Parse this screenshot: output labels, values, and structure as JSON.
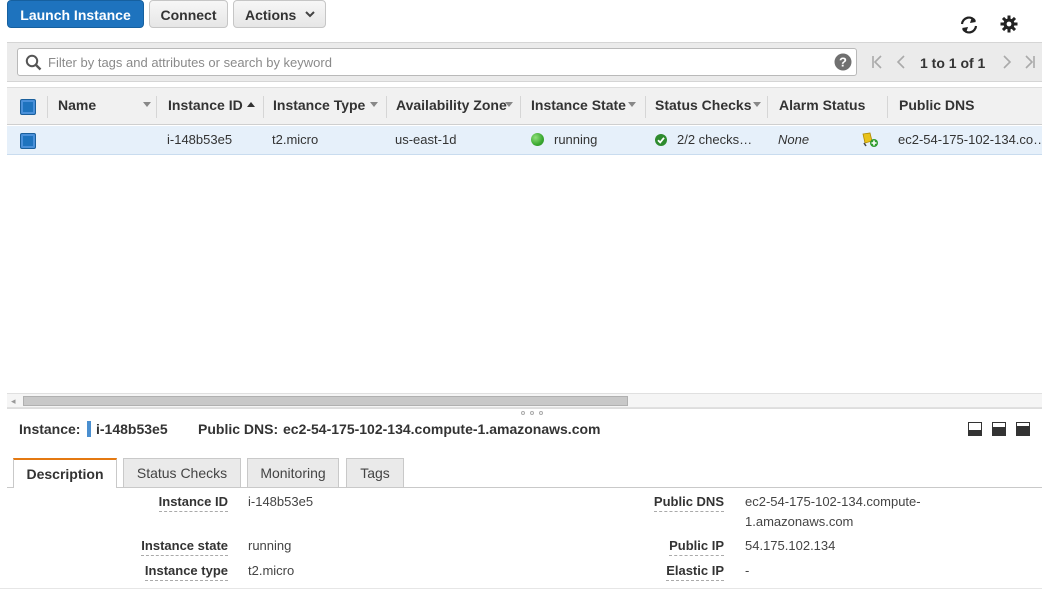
{
  "toolbar": {
    "launch_label": "Launch Instance",
    "connect_label": "Connect",
    "actions_label": "Actions",
    "refresh_icon": "refresh-icon",
    "settings_icon": "gear-icon"
  },
  "filter": {
    "placeholder": "Filter by tags and attributes or search by keyword",
    "help_icon": "question-icon",
    "pagination": "1 to 1 of 1"
  },
  "columns": [
    "Name",
    "Instance ID",
    "Instance Type",
    "Availability Zone",
    "Instance State",
    "Status Checks",
    "Alarm Status",
    "Public DNS"
  ],
  "rows": [
    {
      "name": "",
      "instance_id": "i-148b53e5",
      "instance_type": "t2.micro",
      "availability_zone": "us-east-1d",
      "instance_state": "running",
      "status_checks": "2/2 checks…",
      "alarm_status": "None",
      "public_dns": "ec2-54-175-102-134.co…"
    }
  ],
  "detail_header": {
    "instance_label": "Instance:",
    "instance_id": "i-148b53e5",
    "public_dns_label": "Public DNS:",
    "public_dns": "ec2-54-175-102-134.compute-1.amazonaws.com"
  },
  "tabs": [
    "Description",
    "Status Checks",
    "Monitoring",
    "Tags"
  ],
  "description": {
    "left": [
      {
        "label": "Instance ID",
        "value": "i-148b53e5"
      },
      {
        "label": "Instance state",
        "value": "running"
      },
      {
        "label": "Instance type",
        "value": "t2.micro"
      }
    ],
    "right": [
      {
        "label": "Public DNS",
        "value": "ec2-54-175-102-134.compute-",
        "value2": "1.amazonaws.com"
      },
      {
        "label": "Public IP",
        "value": "54.175.102.134"
      },
      {
        "label": "Elastic IP",
        "value": "-"
      }
    ]
  },
  "colors": {
    "primary": "#1e73be",
    "running": "#3aa830",
    "tab_accent": "#e47911"
  }
}
